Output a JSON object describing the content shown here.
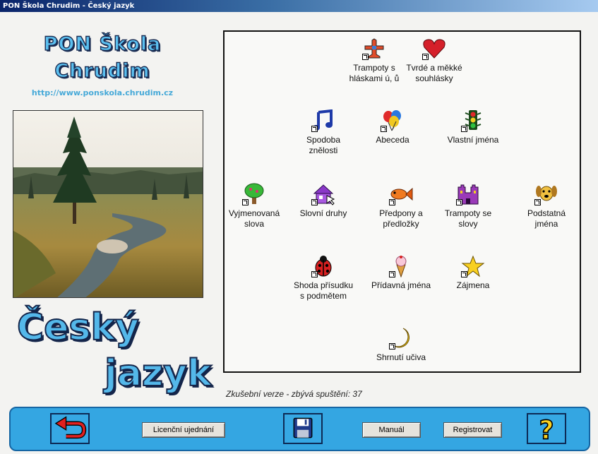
{
  "window": {
    "title": "PON Škola Chrudim - Český jazyk"
  },
  "header": {
    "school_line1": "PON Škola",
    "school_line2": "Chrudim",
    "url": "http://www.ponskola.chrudim.cz"
  },
  "subject": {
    "line1": "Český",
    "line2": "jazyk"
  },
  "panel": {
    "items": [
      {
        "label": "Trampoty s hláskami ú, ů",
        "icon": "airplane-icon"
      },
      {
        "label": "Tvrdé a měkké souhlásky",
        "icon": "heart-icon"
      },
      {
        "label": "Spodoba znělosti",
        "icon": "music-note-icon"
      },
      {
        "label": "Abeceda",
        "icon": "balloons-icon"
      },
      {
        "label": "Vlastní jména",
        "icon": "traffic-light-icon"
      },
      {
        "label": "Vyjmenovaná slova",
        "icon": "tree-icon"
      },
      {
        "label": "Slovní druhy",
        "icon": "house-icon"
      },
      {
        "label": "Předpony a předložky",
        "icon": "fish-icon"
      },
      {
        "label": "Trampoty se slovy",
        "icon": "castle-icon"
      },
      {
        "label": "Podstatná jména",
        "icon": "dog-icon"
      },
      {
        "label": "Shoda přísudku s podmětem",
        "icon": "ladybug-icon"
      },
      {
        "label": "Přídavná jména",
        "icon": "ice-cream-icon"
      },
      {
        "label": "Zájmena",
        "icon": "star-icon"
      },
      {
        "label": "Shrnutí učiva",
        "icon": "moon-icon"
      }
    ]
  },
  "status": {
    "trial_text": "Zkušební verze - zbývá spuštění: 37"
  },
  "toolbar": {
    "license_label": "Licenční ujednání",
    "manual_label": "Manuál",
    "register_label": "Registrovat",
    "back_icon": "back-arrow-icon",
    "save_icon": "floppy-disk-icon",
    "help_icon": "question-mark-icon"
  }
}
